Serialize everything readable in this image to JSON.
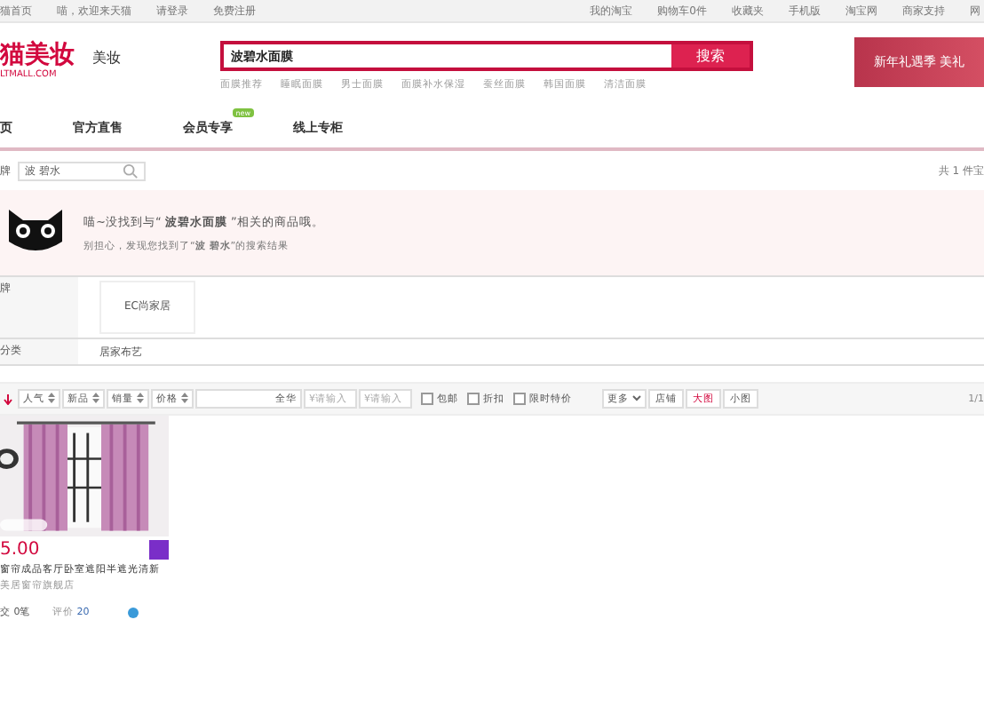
{
  "top_bar": {
    "left_links": [
      "猫首页",
      "喵，欢迎来天猫",
      "请登录",
      "免费注册"
    ],
    "right_links": [
      "我的淘宝",
      "购物车0件",
      "收藏夹",
      "手机版",
      "淘宝网",
      "商家支持",
      "网"
    ]
  },
  "header": {
    "logo": "猫美妆",
    "logo_sub": "LTMALL.COM",
    "channel": "美妆",
    "search": {
      "value": "波碧水面膜",
      "button": "搜索"
    },
    "suggestions": [
      "面膜推荐",
      "睡眠面膜",
      "男士面膜",
      "面膜补水保湿",
      "蚕丝面膜",
      "韩国面膜",
      "清洁面膜"
    ],
    "banner": {
      "title": "新年礼遇季 美礼"
    }
  },
  "nav": [
    {
      "label": "页"
    },
    {
      "label": "官方直售"
    },
    {
      "label": "会员专享",
      "badge": "new"
    },
    {
      "label": "线上专柜"
    }
  ],
  "crumb": {
    "label": "牌",
    "filter": "波 碧水",
    "count": "共 1 件宝"
  },
  "notice": {
    "line1": "喵~没找到与“ **波碧水面膜** ”相关的商品哦。",
    "line2": "别担心，发现您找到了“**波 碧水**”的搜索结果"
  },
  "filters": [
    {
      "label": "牌",
      "kind": "chip",
      "value": "EC尚家居"
    },
    {
      "label": "分类",
      "kind": "text",
      "value": "居家布艺"
    }
  ],
  "sort_bar": {
    "sorts": [
      "人气",
      "新品",
      "销量",
      "价格"
    ],
    "location": "全华",
    "price_from": "¥请输入",
    "price_to": "¥请输入",
    "options": [
      {
        "label": "包邮",
        "checked": false
      },
      {
        "label": "折扣",
        "checked": false
      },
      {
        "label": "限时特价",
        "checked": false
      }
    ],
    "more": "更多",
    "views": [
      {
        "label": "店铺",
        "selected": false
      },
      {
        "label": "大图",
        "selected": true
      },
      {
        "label": "小图",
        "selected": false
      }
    ],
    "page": "1/1"
  },
  "products": [
    {
      "price": "5.00",
      "title": "窗帘成品客厅卧室遮阳半遮光清新",
      "shop": "美居窗帘旗舰店",
      "sales": "交 0笔",
      "reviews_label": "评价",
      "reviews": "20"
    }
  ]
}
